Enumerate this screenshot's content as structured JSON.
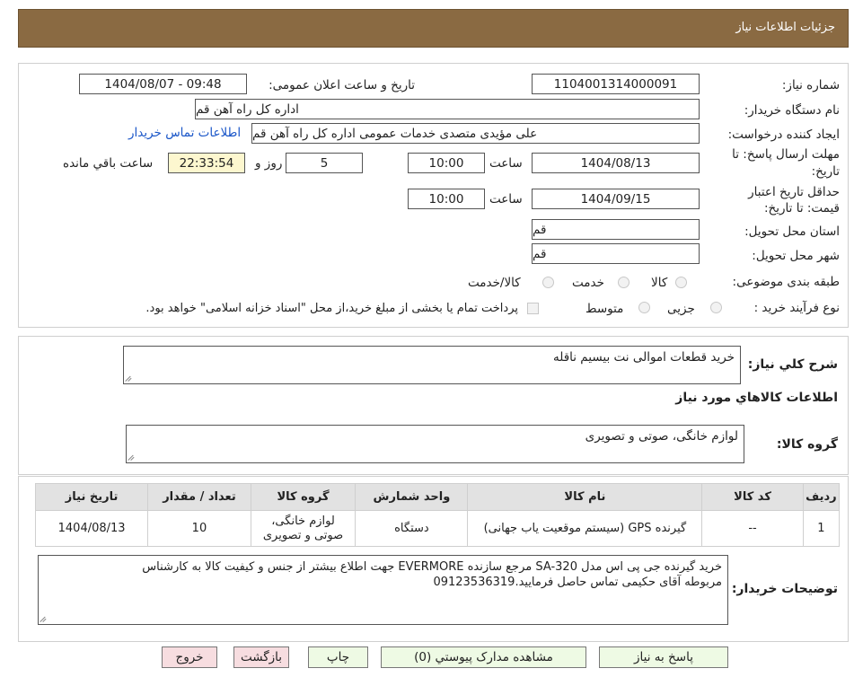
{
  "header": {
    "title": "جزئیات اطلاعات نیاز"
  },
  "form": {
    "need_number_label": "شماره نیاز:",
    "need_number": "1104001314000091",
    "announce_label": "تاریخ و ساعت اعلان عمومی:",
    "announce_value": "1404/08/07 - 09:48",
    "buyer_org_label": "نام دستگاه خریدار:",
    "buyer_org": "اداره کل  راه آهن قم",
    "requester_label": "ایجاد کننده درخواست:",
    "requester": "علی مؤیدی متصدی خدمات عمومی اداره کل  راه آهن قم",
    "contact_link": "اطلاعات تماس خریدار",
    "deadline_label_1": "مهلت ارسال پاسخ: تا",
    "deadline_label_2": "تاریخ:",
    "deadline_date": "1404/08/13",
    "time_word": "ساعت",
    "deadline_time": "10:00",
    "days_value": "5",
    "days_word": "روز و",
    "remaining_time": "22:33:54",
    "remaining_word": "ساعت باقي مانده",
    "validity_label_1": "حداقل تاریخ اعتبار",
    "validity_label_2": "قیمت: تا تاریخ:",
    "validity_date": "1404/09/15",
    "validity_time": "10:00",
    "province_label": "استان محل تحویل:",
    "province": "قم",
    "city_label": "شهر محل تحویل:",
    "city": "قم",
    "category_label": "طبقه بندی موضوعی:",
    "category_options": [
      "کالا",
      "خدمت",
      "کالا/خدمت"
    ],
    "process_label": "نوع فرآیند خرید :",
    "process_options": [
      "جزیی",
      "متوسط"
    ],
    "payment_note": "پرداخت تمام یا بخشی از مبلغ خرید،از محل \"اسناد خزانه اسلامی\" خواهد بود."
  },
  "summary": {
    "description_label": "شرح کلي نياز:",
    "description": "خرید قطعات اموالی نت بیسیم ناقله",
    "goods_info_title": "اطلاعات کالاهاي مورد نياز",
    "goods_group_label": "گروه کالا:",
    "goods_group": "لوازم خانگی، صوتی و تصویری"
  },
  "table": {
    "headers": [
      "رديف",
      "کد کالا",
      "نام کالا",
      "واحد شمارش",
      "گروه کالا",
      "تعداد / مقدار",
      "تاریخ نیاز"
    ],
    "row": {
      "index": "1",
      "code": "--",
      "name": "گیرنده GPS (سیستم موقعیت یاب جهانی)",
      "unit": "دستگاه",
      "group_line1": "لوازم خانگی،",
      "group_line2": "صوتی و تصویری",
      "quantity": "10",
      "date": "1404/08/13"
    }
  },
  "buyer_notes": {
    "label": "توضیحات خریدار:",
    "line1": "خرید گیرنده جی پی اس مدل SA-320 مرجع سازنده EVERMORE  جهت اطلاع بیشتر از جنس و کیفیت کالا به کارشناس",
    "line2": "مربوطه آقای حکیمی تماس حاصل فرمایید.09123536319"
  },
  "buttons": {
    "reply": "پاسخ به نیاز",
    "attachments": "مشاهده مدارک پیوستي (0)",
    "print": "چاپ",
    "back": "بازگشت",
    "exit": "خروج"
  },
  "colors": {
    "header_bg": "#8a6a42",
    "remaining_bg": "#fdf7cf",
    "back_button_bg": "#f7dde0",
    "exit_button_bg": "#f7dde0",
    "action_button_bg": "#eefae4",
    "link": "#1a56c8"
  }
}
